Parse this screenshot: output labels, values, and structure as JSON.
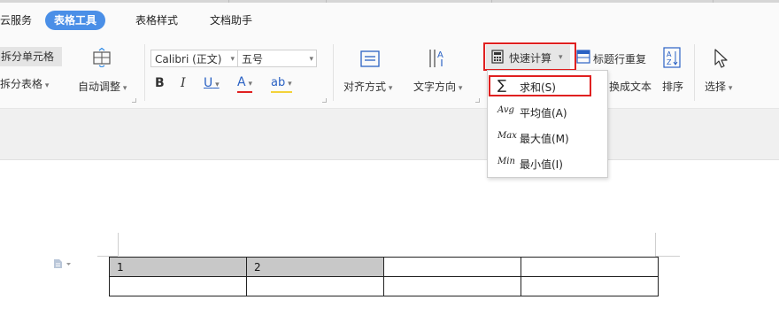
{
  "tabs": {
    "cloud": "云服务",
    "table_tools": "表格工具",
    "table_style": "表格样式",
    "doc_assistant": "文档助手"
  },
  "ribbon": {
    "split_cell": "拆分单元格",
    "split_table": "拆分表格",
    "auto_adjust": "自动调整",
    "font_name": "Calibri (正文)",
    "font_size": "五号",
    "bold": "B",
    "italic": "I",
    "underline": "U",
    "font_color": "A",
    "highlight": "ab",
    "align": "对齐方式",
    "text_direction": "文字方向",
    "quick_calc": "快速计算",
    "title_repeat": "标题行重复",
    "to_text": "换成文本",
    "sort": "排序",
    "select": "选择"
  },
  "menu": {
    "items": [
      {
        "icon": "∑",
        "label": "求和(S)"
      },
      {
        "icon": "Avg",
        "label": "平均值(A)"
      },
      {
        "icon": "Max",
        "label": "最大值(M)"
      },
      {
        "icon": "Min",
        "label": "最小值(I)"
      }
    ]
  },
  "table": {
    "rows": [
      [
        "1",
        "2",
        "",
        ""
      ],
      [
        "",
        "",
        "",
        ""
      ]
    ]
  },
  "colors": {
    "accent": "#4a8fe7",
    "highlight_border": "#e02020",
    "selected_cell": "#c8c8c8"
  }
}
